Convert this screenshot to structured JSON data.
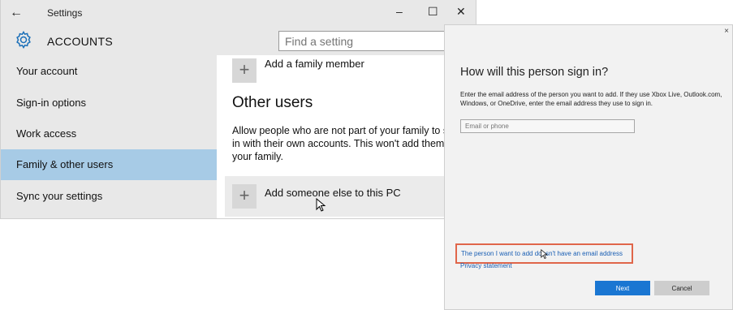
{
  "window": {
    "back_icon": "arrow-left-icon",
    "title": "Settings",
    "minimize": "–",
    "maximize": "☐",
    "close": "✕"
  },
  "header": {
    "section_icon": "gear-icon",
    "section_title": "ACCOUNTS",
    "search_placeholder": "Find a setting"
  },
  "sidebar": {
    "items": [
      {
        "label": "Your account",
        "active": false
      },
      {
        "label": "Sign-in options",
        "active": false
      },
      {
        "label": "Work access",
        "active": false
      },
      {
        "label": "Family & other users",
        "active": true
      },
      {
        "label": "Sync your settings",
        "active": false
      }
    ]
  },
  "content": {
    "add_family_icon": "+",
    "add_family_label": "Add a family member",
    "other_users_heading": "Other users",
    "other_users_desc": [
      "Allow people who are not part of your family to si",
      "in with their own accounts. This won't add them t",
      "your family."
    ],
    "add_else_icon": "+",
    "add_else_label": "Add someone else to this PC"
  },
  "dialog": {
    "close": "×",
    "title": "How will this person sign in?",
    "description": "Enter the email address of the person you want to add. If they use Xbox Live, Outlook.com, Windows, or OneDrive, enter the email address they use to sign in.",
    "email_placeholder": "Email or phone",
    "no_email_link": "The person I want to add doesn't have an email address",
    "privacy_link": "Privacy statement",
    "next_label": "Next",
    "cancel_label": "Cancel",
    "highlight_color": "#e0664a",
    "accent_color": "#1a76d2"
  }
}
